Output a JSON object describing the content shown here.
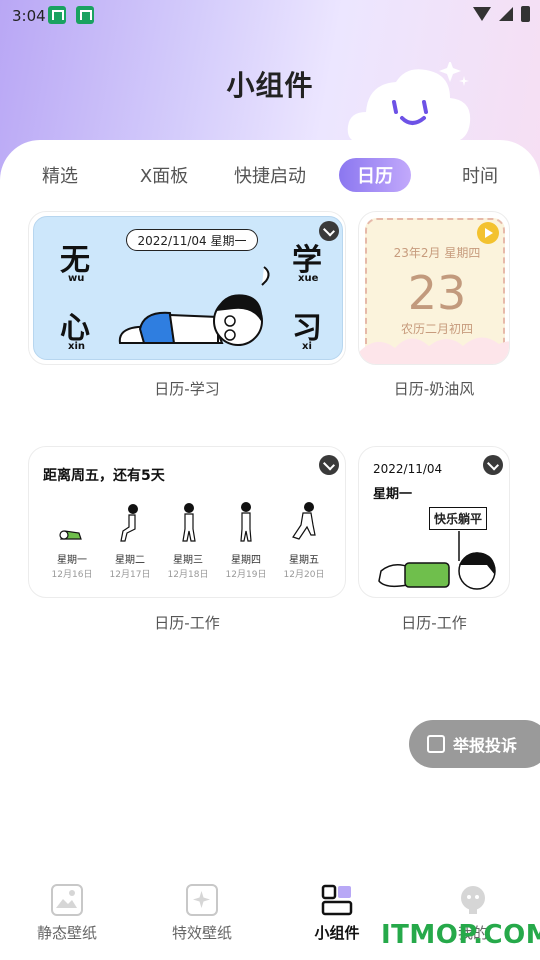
{
  "status_bar": {
    "time": "3:04"
  },
  "header": {
    "title": "小组件"
  },
  "tabs": [
    {
      "label": "精选"
    },
    {
      "label": "X面板"
    },
    {
      "label": "快捷启动"
    },
    {
      "label": "日历",
      "active": true
    },
    {
      "label": "时间"
    }
  ],
  "widgets": {
    "study": {
      "date": "2022/11/04 星期一",
      "chars": [
        {
          "char": "无",
          "pinyin": "wu"
        },
        {
          "char": "学",
          "pinyin": "xue"
        },
        {
          "char": "心",
          "pinyin": "xin"
        },
        {
          "char": "习",
          "pinyin": "xi"
        }
      ],
      "caption": "日历-学习"
    },
    "cream": {
      "date": "23年2月 星期四",
      "day": "23",
      "lunar": "农历二月初四",
      "caption": "日历-奶油风"
    },
    "work_week": {
      "title": "距离周五，还有5天",
      "days": [
        {
          "weekday": "星期一",
          "date": "12月16日"
        },
        {
          "weekday": "星期二",
          "date": "12月17日"
        },
        {
          "weekday": "星期三",
          "date": "12月18日"
        },
        {
          "weekday": "星期四",
          "date": "12月19日"
        },
        {
          "weekday": "星期五",
          "date": "12月20日"
        }
      ],
      "caption": "日历-工作"
    },
    "work_day": {
      "date": "2022/11/04",
      "weekday": "星期一",
      "sign": "快乐躺平",
      "caption": "日历-工作"
    }
  },
  "report_button": {
    "label": "举报投诉"
  },
  "bottom_nav": [
    {
      "label": "静态壁纸",
      "icon": "image-icon"
    },
    {
      "label": "特效壁纸",
      "icon": "sparkle-image-icon"
    },
    {
      "label": "小组件",
      "icon": "widget-icon",
      "active": true
    },
    {
      "label": "我的",
      "icon": "profile-icon"
    }
  ],
  "watermark": "ITMOP.COM",
  "colors": {
    "accent": "#8b77f0",
    "watermark": "#26a94a",
    "cream_text": "#c29a7d"
  }
}
